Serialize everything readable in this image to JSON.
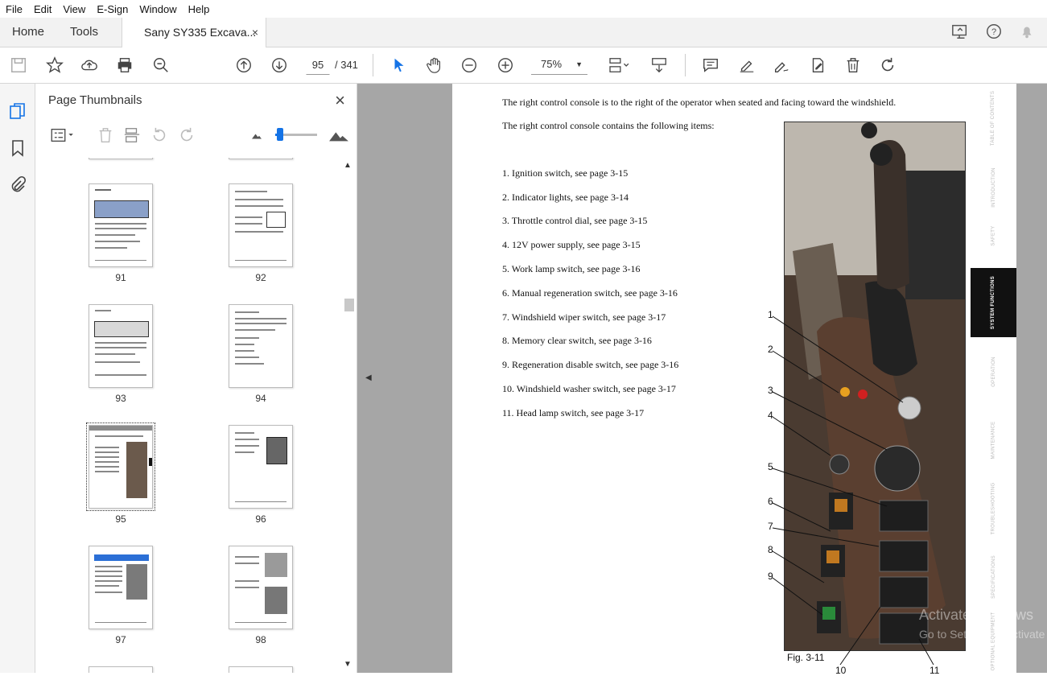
{
  "menu": [
    "File",
    "Edit",
    "View",
    "E-Sign",
    "Window",
    "Help"
  ],
  "tabs": {
    "home": "Home",
    "tools": "Tools",
    "document": "Sany SY335 Excava...",
    "close": "×"
  },
  "toolbar": {
    "current_page": "95",
    "total_pages": "/ 341",
    "zoom": "75%",
    "zoom_caret": "▼"
  },
  "panel": {
    "title": "Page Thumbnails",
    "close": "×"
  },
  "thumbnails": [
    {
      "label": "91"
    },
    {
      "label": "92"
    },
    {
      "label": "93"
    },
    {
      "label": "94"
    },
    {
      "label": "95",
      "selected": true
    },
    {
      "label": "96"
    },
    {
      "label": "97"
    },
    {
      "label": "98"
    }
  ],
  "document": {
    "intro1": "The right control console is to the right of the operator when seated and facing toward the windshield.",
    "intro2": "The right control console contains the following items:",
    "items": [
      "1.   Ignition switch, see page 3-15",
      "2.   Indicator lights, see page 3-14",
      "3.   Throttle control dial, see page 3-15",
      "4.   12V power supply, see page 3-15",
      "5.   Work lamp switch, see page 3-16",
      "6.   Manual regeneration switch, see page 3-16",
      "7.   Windshield wiper switch, see page 3-17",
      "8.   Memory clear switch, see page 3-16",
      "9.   Regeneration disable switch, see page 3-16",
      "10.   Windshield washer switch, see page 3-17",
      "11.   Head lamp switch, see page 3-17"
    ],
    "figure_caption": "Fig. 3-11",
    "callouts": [
      "1",
      "2",
      "3",
      "4",
      "5",
      "6",
      "7",
      "8",
      "9",
      "10",
      "11"
    ]
  },
  "side_tabs": [
    {
      "label": "TABLE OF CONTENTS"
    },
    {
      "label": "INTRODUCTION"
    },
    {
      "label": "SAFETY"
    },
    {
      "label": "SYSTEM FUNCTIONS",
      "active": true
    },
    {
      "label": "OPERATION"
    },
    {
      "label": "MAINTENANCE"
    },
    {
      "label": "TROUBLESHOOTING"
    },
    {
      "label": "SPECIFICATIONS"
    },
    {
      "label": "OPTIONAL EQUIPMENT"
    }
  ],
  "watermark": {
    "line1": "Activate Windows",
    "line2": "Go to Settings to activate"
  },
  "colors": {
    "accent": "#1473e6",
    "viewer_bg": "#a6a6a6",
    "active_tab": "#111111"
  }
}
